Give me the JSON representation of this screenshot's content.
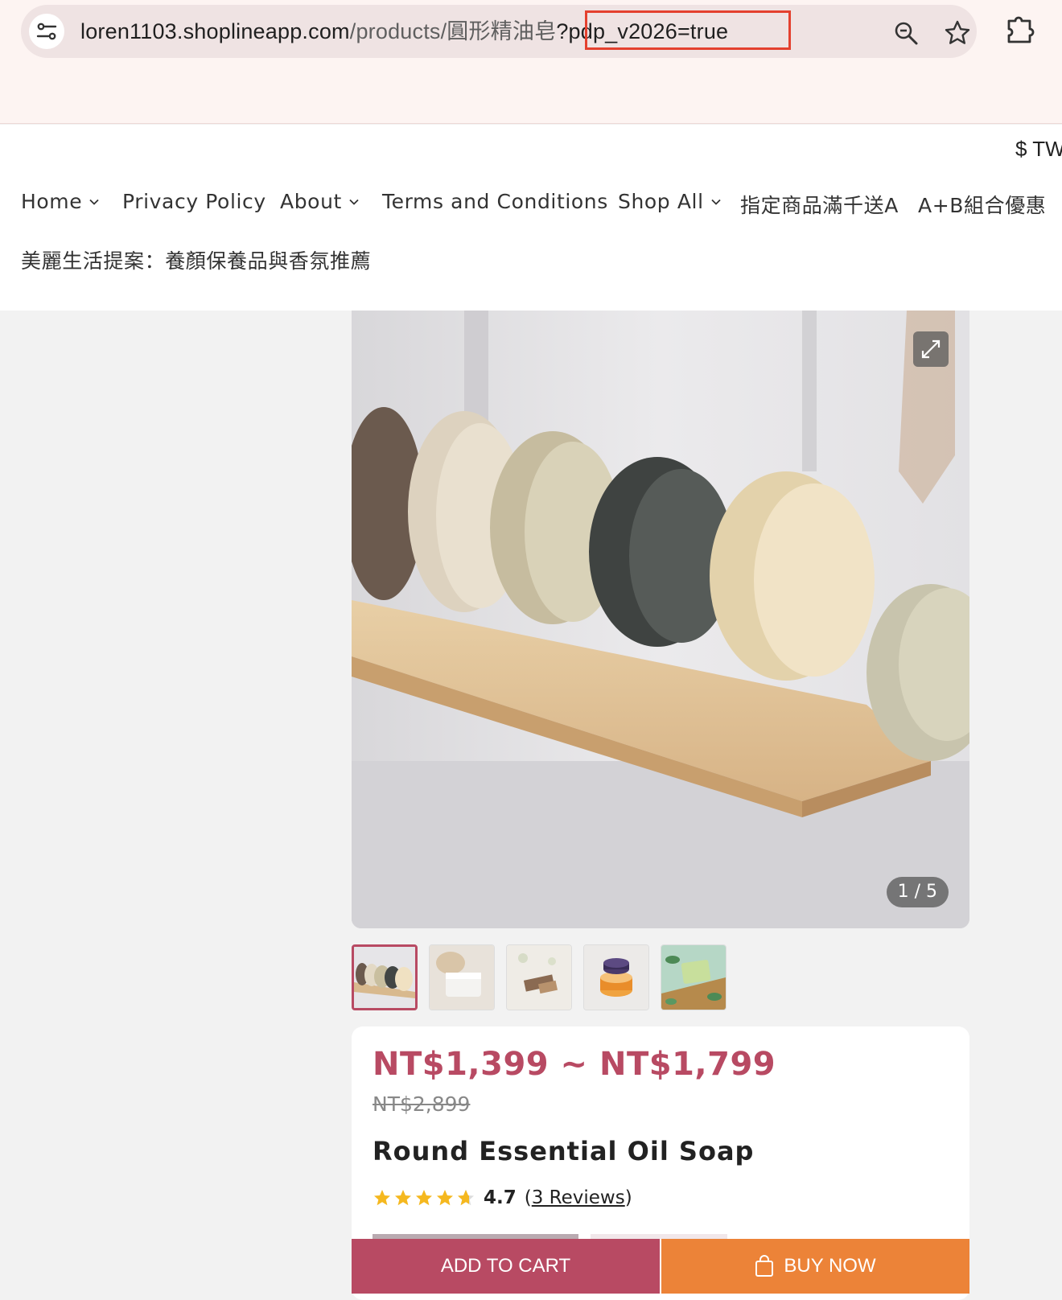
{
  "browser": {
    "url_host": "loren1103.shoplineapp.com",
    "url_path": "/products/圓形精油皂",
    "url_query": "?pdp_v2026=true",
    "icons": [
      "site-info-icon",
      "zoom-icon",
      "star-icon",
      "extensions-icon"
    ]
  },
  "header": {
    "currency": "$ TW"
  },
  "nav": {
    "items": [
      {
        "label": "Home",
        "dropdown": true
      },
      {
        "label": "Privacy Policy",
        "dropdown": false
      },
      {
        "label": "About",
        "dropdown": true
      },
      {
        "label": "Terms and Conditions",
        "dropdown": false
      },
      {
        "label": "Shop All",
        "dropdown": true
      },
      {
        "label": "指定商品滿千送A",
        "dropdown": false
      },
      {
        "label": "A+B組合優惠",
        "dropdown": false
      }
    ],
    "row2": "美麗生活提案：養顏保養品與香氛推薦"
  },
  "gallery": {
    "counter": "1 / 5",
    "thumbnail_count": 5
  },
  "product": {
    "price_range": "NT$1,399 ~ NT$1,799",
    "original_price": "NT$2,899",
    "title": "Round Essential Oil Soap",
    "rating": 4.7,
    "rating_text": "4.7",
    "reviews_label": "3 Reviews"
  },
  "actions": {
    "add_to_cart": "ADD TO CART",
    "buy_now": "BUY NOW"
  },
  "colors": {
    "brand": "#b84a63",
    "buy": "#ec8338",
    "star": "#f5b81f",
    "highlight": "#e4412f"
  }
}
